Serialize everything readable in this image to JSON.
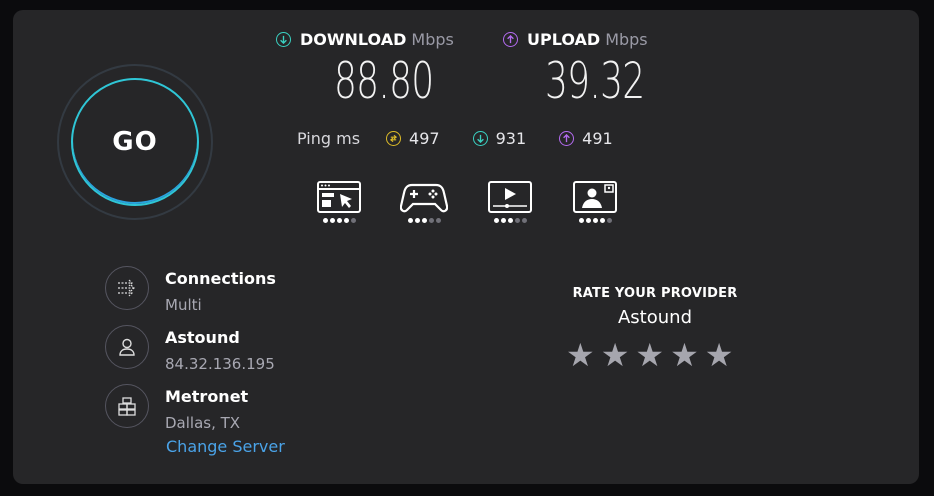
{
  "go_label": "GO",
  "download": {
    "label": "DOWNLOAD",
    "unit": "Mbps",
    "value": "88.80",
    "color": "#3ad1c2",
    "icon": "arrow-down-circle-icon"
  },
  "upload": {
    "label": "UPLOAD",
    "unit": "Mbps",
    "value": "39.32",
    "color": "#b36bf0",
    "icon": "arrow-up-circle-icon"
  },
  "ping": {
    "label": "Ping ms",
    "idle": "497",
    "download": "931",
    "upload": "491",
    "idle_color": "#dcbb28"
  },
  "activities": [
    {
      "name": "web-browsing",
      "icon": "browser-cursor-icon",
      "rating": 4,
      "max": 5
    },
    {
      "name": "gaming",
      "icon": "gamepad-icon",
      "rating": 3,
      "max": 5
    },
    {
      "name": "video-streaming",
      "icon": "video-player-icon",
      "rating": 3,
      "max": 5
    },
    {
      "name": "video-calling",
      "icon": "video-call-icon",
      "rating": 4,
      "max": 5
    }
  ],
  "info": {
    "connections": {
      "title": "Connections",
      "value": "Multi",
      "icon": "connections-icon"
    },
    "provider": {
      "title": "Astound",
      "value": "84.32.136.195",
      "icon": "user-icon"
    },
    "server": {
      "title": "Metronet",
      "value": "Dallas, TX",
      "icon": "server-icon"
    },
    "change_server": "Change Server"
  },
  "rate": {
    "title": "RATE YOUR PROVIDER",
    "provider": "Astound",
    "stars": 5
  }
}
